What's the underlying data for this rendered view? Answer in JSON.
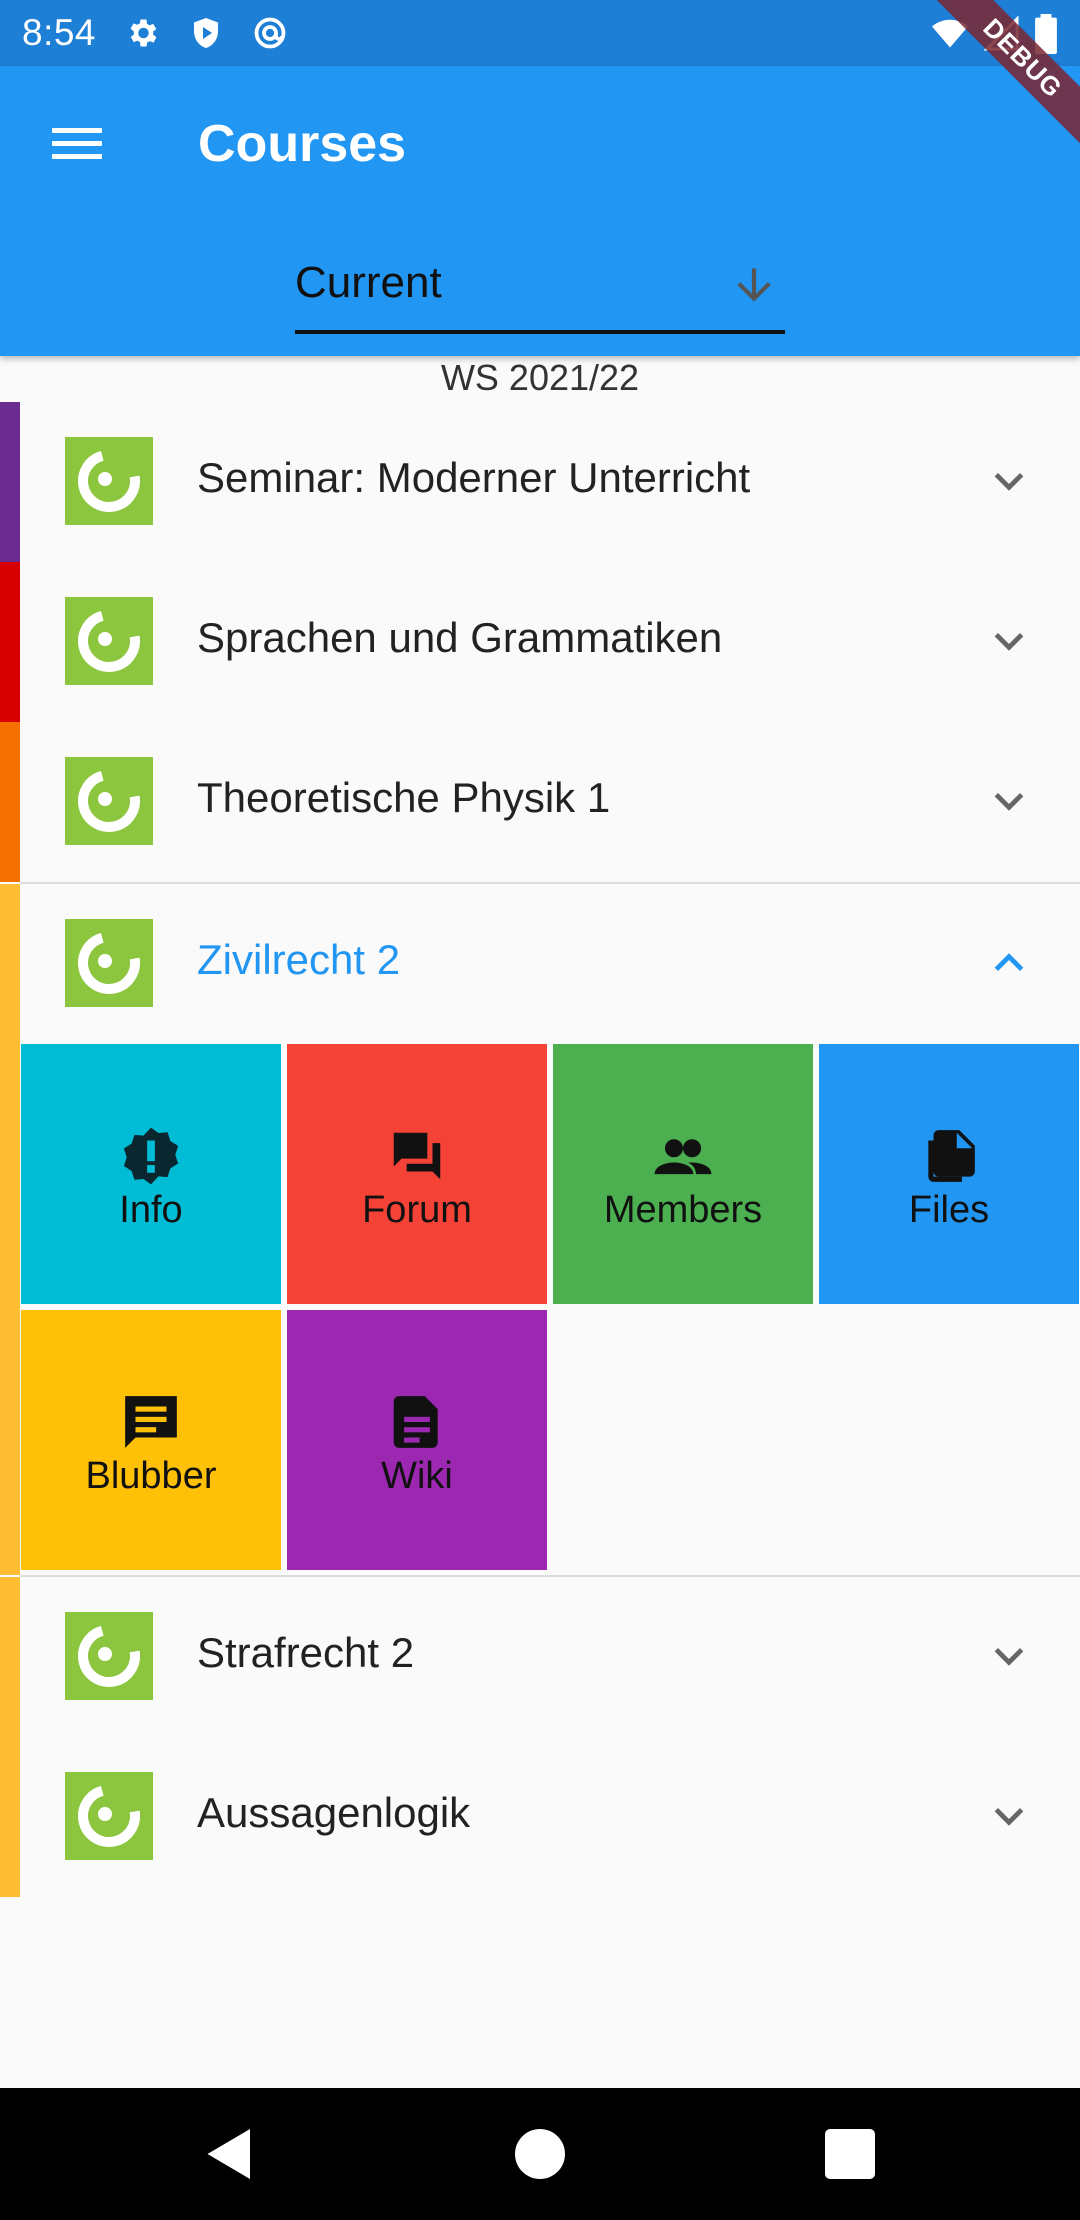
{
  "status_bar": {
    "time": "8:54",
    "left_icons": [
      "gear-icon",
      "shield-icon",
      "at-icon"
    ],
    "right_icons": [
      "wifi-icon",
      "signal-icon",
      "battery-icon"
    ]
  },
  "debug_banner": "DEBUG",
  "app_bar": {
    "title": "Courses",
    "menu_icon": "menu-icon",
    "filter_value": "Current"
  },
  "semester_label": "WS 2021/22",
  "courses_before": [
    {
      "name": "Seminar: Moderner Unterricht",
      "color": "#6a2c91"
    },
    {
      "name": "Sprachen und Grammatiken",
      "color": "#d60000"
    },
    {
      "name": "Theoretische Physik 1",
      "color": "#f57000"
    }
  ],
  "active_course": {
    "name": "Zivilrecht 2",
    "color": "#fdbd33"
  },
  "tiles": [
    {
      "label": "Info",
      "icon": "info-icon",
      "color": "#00bcd4"
    },
    {
      "label": "Forum",
      "icon": "forum-icon",
      "color": "#f44336"
    },
    {
      "label": "Members",
      "icon": "members-icon",
      "color": "#4caf50"
    },
    {
      "label": "Files",
      "icon": "files-icon",
      "color": "#2196f3"
    },
    {
      "label": "Blubber",
      "icon": "blubber-icon",
      "color": "#ffc107"
    },
    {
      "label": "Wiki",
      "icon": "wiki-icon",
      "color": "#9c27b0"
    }
  ],
  "courses_after": [
    {
      "name": "Strafrecht 2",
      "color": "#fdbd33"
    },
    {
      "name": "Aussagenlogik",
      "color": "#fdbd33"
    }
  ],
  "nav_bar": [
    "back-icon",
    "home-icon",
    "recents-icon"
  ]
}
